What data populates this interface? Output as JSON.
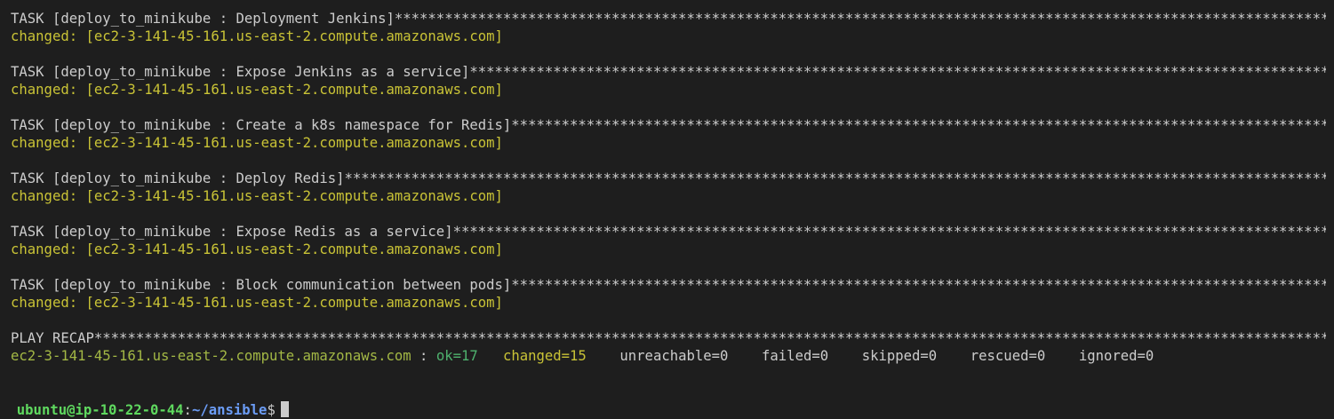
{
  "colors": {
    "background": "#1e1e1e",
    "text": "#cccccc",
    "changed": "#c9c336",
    "ok": "#4fb36e",
    "prompt_user": "#5fd95f",
    "prompt_path": "#6b9cf5"
  },
  "tasks": [
    {
      "header": "TASK [deploy_to_minikube : Deployment Jenkins] ",
      "status": "changed: [ec2-3-141-45-161.us-east-2.compute.amazonaws.com]"
    },
    {
      "header": "TASK [deploy_to_minikube : Expose Jenkins as a service] ",
      "status": "changed: [ec2-3-141-45-161.us-east-2.compute.amazonaws.com]"
    },
    {
      "header": "TASK [deploy_to_minikube : Create a k8s namespace for Redis] ",
      "status": "changed: [ec2-3-141-45-161.us-east-2.compute.amazonaws.com]"
    },
    {
      "header": "TASK [deploy_to_minikube : Deploy Redis] ",
      "status": "changed: [ec2-3-141-45-161.us-east-2.compute.amazonaws.com]"
    },
    {
      "header": "TASK [deploy_to_minikube : Expose Redis as a service] ",
      "status": "changed: [ec2-3-141-45-161.us-east-2.compute.amazonaws.com]"
    },
    {
      "header": "TASK [deploy_to_minikube : Block communication between pods] ",
      "status": "changed: [ec2-3-141-45-161.us-east-2.compute.amazonaws.com]"
    }
  ],
  "recap": {
    "header": "PLAY RECAP ",
    "host": "ec2-3-141-45-161.us-east-2.compute.amazonaws.com",
    "separator": " : ",
    "ok": "ok=17",
    "changed": "changed=15",
    "unreachable": "unreachable=0",
    "failed": "failed=0",
    "skipped": "skipped=0",
    "rescued": "rescued=0",
    "ignored": "ignored=0"
  },
  "prompt": {
    "user_host": "ubuntu@ip-10-22-0-44",
    "colon": ":",
    "path": "~/ansible",
    "dollar": "$"
  },
  "stars": "**************************************************************************************************************************************************************************************************"
}
